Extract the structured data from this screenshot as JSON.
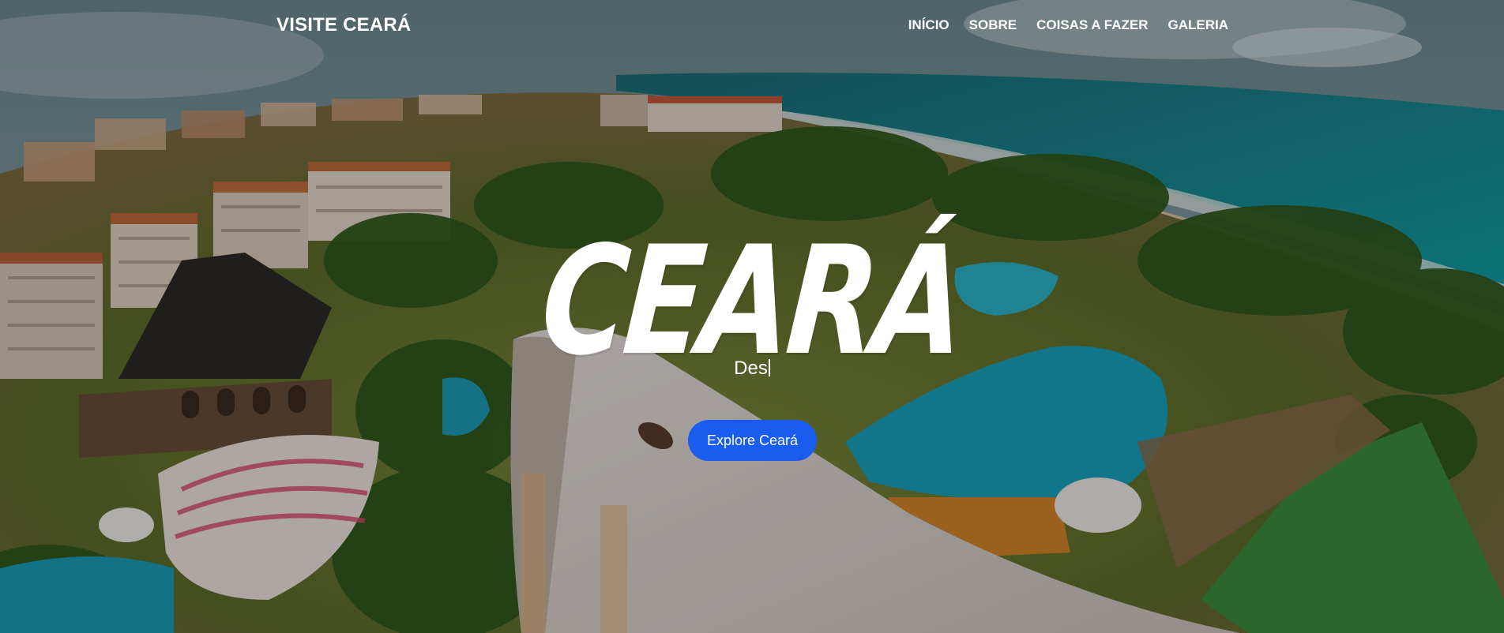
{
  "navbar": {
    "brand": "VISITE CEARÁ",
    "links": [
      {
        "label": "INÍCIO"
      },
      {
        "label": "SOBRE"
      },
      {
        "label": "COISAS A FAZER"
      },
      {
        "label": "GALERIA"
      }
    ]
  },
  "hero": {
    "title": "CEARÁ",
    "subtitle_typed": "Des",
    "cta_label": "Explore Ceará"
  },
  "colors": {
    "cta_background": "#1a5cf0",
    "text": "#ffffff",
    "ocean": "#1f7d86",
    "overlay": "rgba(0,0,0,0.28)"
  }
}
